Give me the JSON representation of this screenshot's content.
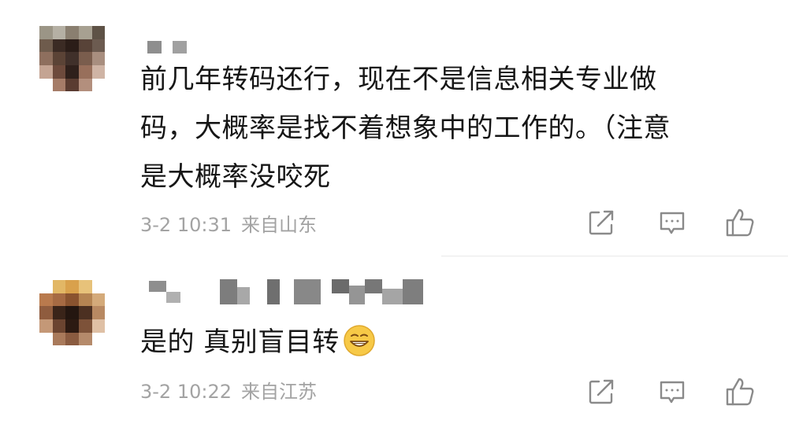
{
  "comments": [
    {
      "username": "",
      "text_lines": [
        "前几年转码还行，现在不是信息相关专业做",
        "码，大概率是找不着想象中的工作的。（注意",
        "是大概率没咬死"
      ],
      "time": "3-2 10:31",
      "location": "来自山东",
      "actions": [
        "share-icon",
        "reply-icon",
        "like-icon"
      ]
    },
    {
      "username": "",
      "text": "是的 真别盲目转",
      "emoji": "grinning-face-emoji",
      "time": "3-2 10:22",
      "location": "来自江苏",
      "actions": [
        "share-icon",
        "reply-icon",
        "like-icon"
      ]
    }
  ],
  "colors": {
    "text": "#161616",
    "meta": "#a3a3a3",
    "icon": "#8a8a8a",
    "divider": "#e9e9e9",
    "emoji_face": "#f7c947"
  }
}
